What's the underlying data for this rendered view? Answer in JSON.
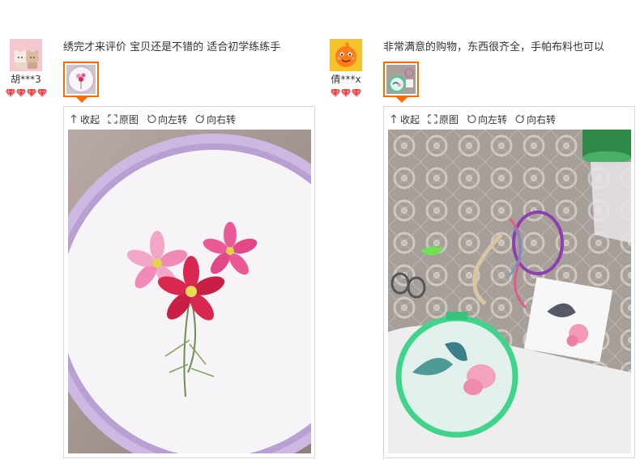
{
  "reviews": [
    {
      "user": "胡***3",
      "avatar_icon": "bears-avatar-icon",
      "gems": 4,
      "comment": "绣完才来评价 宝贝还是不错的 适合初学练练手",
      "photo_subject": "embroidered-pink-cosmos-flowers"
    },
    {
      "user": "倩***x",
      "avatar_icon": "orange-mascot-avatar-icon",
      "gems": 3,
      "comment": "非常满意的购物，东西很齐全，手帕布料也可以",
      "photo_subject": "embroidery-kit-butterfly-hoop"
    }
  ],
  "toolbar": {
    "collapse": "收起",
    "original": "原图",
    "rotate_left": "向左转",
    "rotate_right": "向右转"
  },
  "colors": {
    "accent": "#ff6a00",
    "gem": "#e4393c"
  }
}
